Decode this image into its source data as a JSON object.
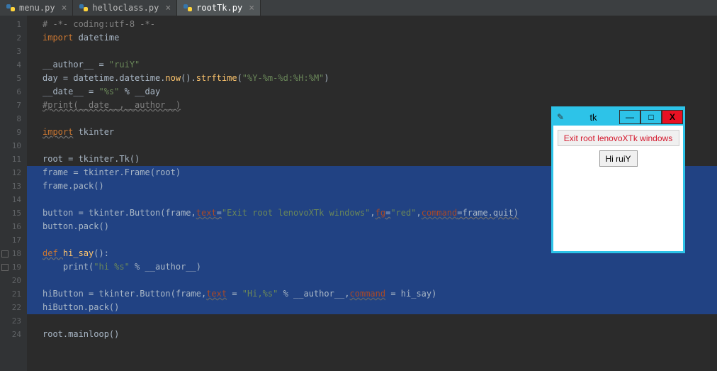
{
  "tabs": [
    {
      "label": "menu.py",
      "active": false
    },
    {
      "label": "helloclass.py",
      "active": false
    },
    {
      "label": "rootTk.py",
      "active": true
    }
  ],
  "code": {
    "l1": "# -*- coding:utf-8 -*-",
    "l2_kw": "import",
    "l2_id": " datetime",
    "l4_a": "__author__ = ",
    "l4_b": "\"ruiY\"",
    "l5_a": "day = datetime.datetime.",
    "l5_b": "now",
    "l5_c": "().",
    "l5_d": "strftime",
    "l5_e": "(",
    "l5_f": "\"%Y-%m-%d:%H:%M\"",
    "l5_g": ")",
    "l6_a": "__date__ = ",
    "l6_b": "\"%s\"",
    "l6_c": " % __day",
    "l7": "#print(__date__,__author__)",
    "l9_kw": "import",
    "l9_id": " tkinter",
    "l11": "root = tkinter.Tk()",
    "l12": "frame = tkinter.Frame(root)",
    "l13": "frame.pack()",
    "l15_a": "button = tkinter.Button(frame,",
    "l15_b": "text",
    "l15_c": "=",
    "l15_d": "\"Exit root lenovoXTk windows\"",
    "l15_e": ",",
    "l15_f": "fg",
    "l15_g": "=",
    "l15_h": "\"red\"",
    "l15_i": ",",
    "l15_j": "command",
    "l15_k": "=frame.quit)",
    "l16": "button.pack()",
    "l18_a": "def ",
    "l18_b": "hi_say",
    "l18_c": "():",
    "l19_a": "    print(",
    "l19_b": "\"hi %s\"",
    "l19_c": " % __author__)",
    "l21_a": "hiButton = tkinter.Button(frame,",
    "l21_b": "text",
    "l21_c": " = ",
    "l21_d": "\"Hi,%s\"",
    "l21_e": " % __author__,",
    "l21_f": "command",
    "l21_g": " = hi_say)",
    "l22": "hiButton.pack()",
    "l24": "root.mainloop()"
  },
  "tk": {
    "title": "tk",
    "exit_label": "Exit root lenovoXTk windows",
    "hi_label": "Hi ruiY"
  }
}
